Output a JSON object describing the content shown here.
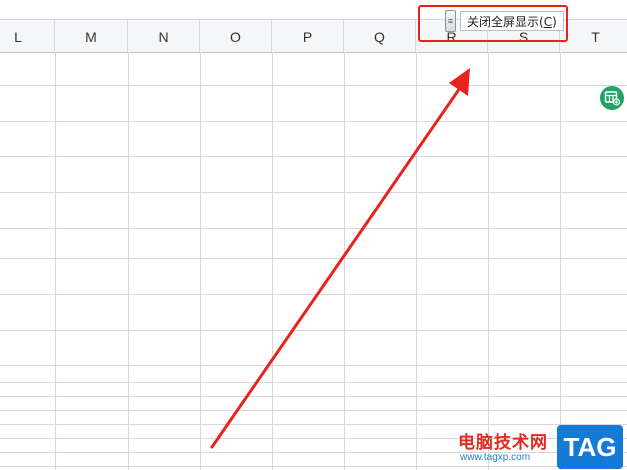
{
  "spreadsheet": {
    "columns": [
      "L",
      "M",
      "N",
      "O",
      "P",
      "Q",
      "R",
      "S",
      "T"
    ]
  },
  "fullscreen_toolbar": {
    "button_label": "关闭全屏显示(",
    "button_shortcut": "C",
    "button_suffix": ")"
  },
  "annotation": {
    "color": "#e8231d"
  },
  "watermark": {
    "site_name": "电脑技术网",
    "url": "www.tagxp.com",
    "badge": "TAG"
  },
  "side_icon": {
    "name": "sheet-plus-icon",
    "color": "#21a366"
  }
}
